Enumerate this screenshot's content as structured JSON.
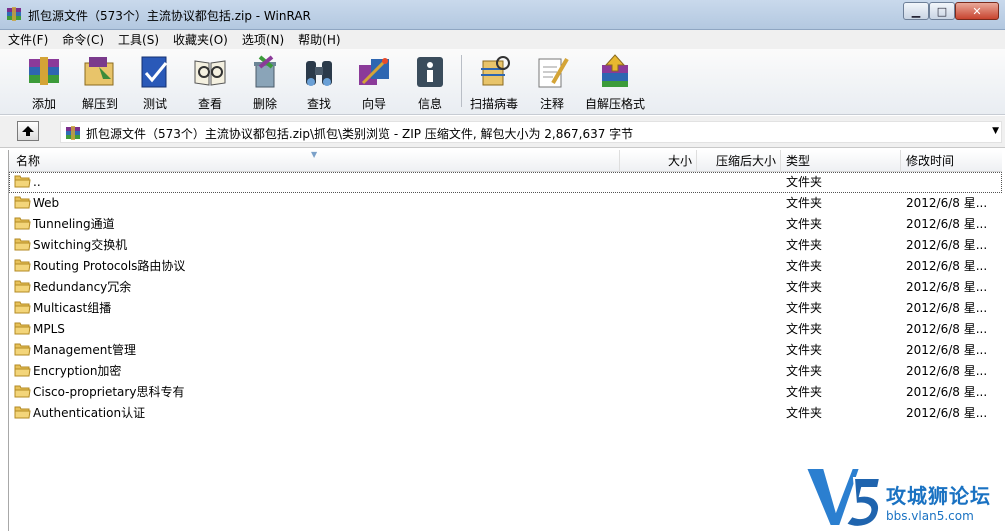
{
  "window": {
    "title": "抓包源文件（573个）主流协议都包括.zip - WinRAR",
    "icon": "winrar-books-icon"
  },
  "menu": [
    "文件(F)",
    "命令(C)",
    "工具(S)",
    "收藏夹(O)",
    "选项(N)",
    "帮助(H)"
  ],
  "toolbar": [
    {
      "label": "添加",
      "icon": "add-archive-icon"
    },
    {
      "label": "解压到",
      "icon": "extract-to-icon"
    },
    {
      "label": "测试",
      "icon": "test-icon"
    },
    {
      "label": "查看",
      "icon": "view-icon"
    },
    {
      "label": "删除",
      "icon": "delete-icon"
    },
    {
      "label": "查找",
      "icon": "find-binoculars-icon"
    },
    {
      "label": "向导",
      "icon": "wizard-icon"
    },
    {
      "label": "信息",
      "icon": "info-icon"
    },
    {
      "label": "扫描病毒",
      "icon": "virus-scan-icon"
    },
    {
      "label": "注释",
      "icon": "comment-icon"
    },
    {
      "label": "自解压格式",
      "icon": "sfx-icon"
    }
  ],
  "address": {
    "path": "抓包源文件（573个）主流协议都包括.zip\\抓包\\类别浏览 - ZIP 压缩文件, 解包大小为 2,867,637 字节"
  },
  "columns": {
    "name": "名称",
    "size": "大小",
    "packed": "压缩后大小",
    "type": "类型",
    "modified": "修改时间"
  },
  "files": [
    {
      "name": "..",
      "type": "文件夹",
      "modified": ""
    },
    {
      "name": "Web",
      "type": "文件夹",
      "modified": "2012/6/8 星..."
    },
    {
      "name": "Tunneling通道",
      "type": "文件夹",
      "modified": "2012/6/8 星..."
    },
    {
      "name": "Switching交换机",
      "type": "文件夹",
      "modified": "2012/6/8 星..."
    },
    {
      "name": "Routing Protocols路由协议",
      "type": "文件夹",
      "modified": "2012/6/8 星..."
    },
    {
      "name": "Redundancy冗余",
      "type": "文件夹",
      "modified": "2012/6/8 星..."
    },
    {
      "name": "Multicast组播",
      "type": "文件夹",
      "modified": "2012/6/8 星..."
    },
    {
      "name": "MPLS",
      "type": "文件夹",
      "modified": "2012/6/8 星..."
    },
    {
      "name": "Management管理",
      "type": "文件夹",
      "modified": "2012/6/8 星..."
    },
    {
      "name": "Encryption加密",
      "type": "文件夹",
      "modified": "2012/6/8 星..."
    },
    {
      "name": "Cisco-proprietary思科专有",
      "type": "文件夹",
      "modified": "2012/6/8 星..."
    },
    {
      "name": "Authentication认证",
      "type": "文件夹",
      "modified": "2012/6/8 星..."
    }
  ],
  "watermark": {
    "logo_text": "攻城狮论坛",
    "url": "bbs.vlan5.com",
    "color": "#1a72c2"
  }
}
